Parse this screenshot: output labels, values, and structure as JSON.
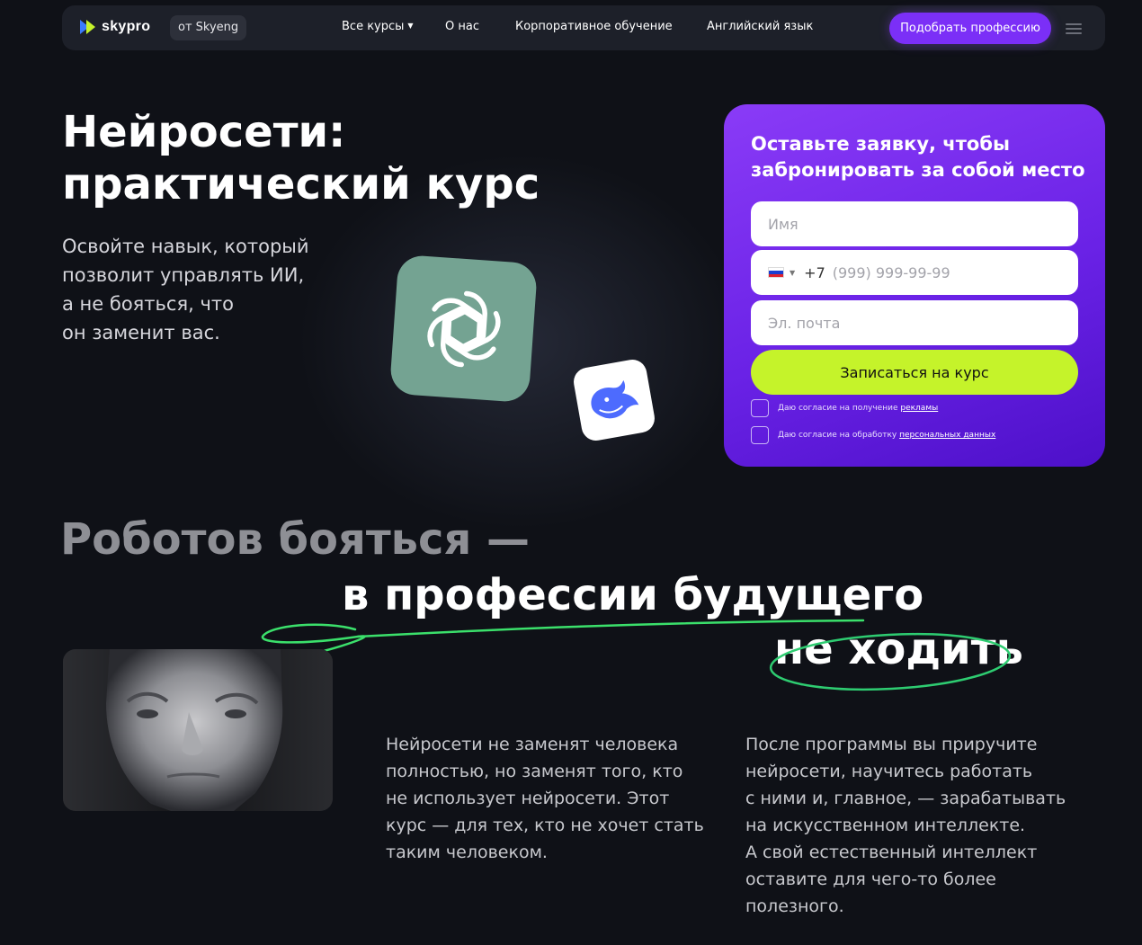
{
  "nav": {
    "logo_text": "skypro",
    "from_badge": "от Skyeng",
    "links": [
      "Все курсы",
      "О нас",
      "Корпоративное обучение",
      "Английский язык"
    ],
    "cta": "Подобрать профессию",
    "menu_icon": "burger-icon"
  },
  "hero": {
    "title_line1": "Нейросети:",
    "title_line2": "практический курс",
    "subtitle": [
      "Освойте навык, который",
      "позволит управлять ИИ,",
      "а не бояться, что",
      "он заменит вас."
    ],
    "icons": [
      "chatgpt-logo",
      "deepseek-logo"
    ]
  },
  "form": {
    "title": "Оставьте заявку, чтобы забронировать за собой место",
    "name_placeholder": "Имя",
    "phone_code": "+7",
    "phone_placeholder": "(999) 999-99-99",
    "email_placeholder": "Эл. почта",
    "submit": "Записаться на курс",
    "consent1_text": "Даю согласие на получение ",
    "consent1_link": "рекламы",
    "consent2_text": "Даю согласие на обработку ",
    "consent2_link": "персональных данных"
  },
  "section2": {
    "heading_grey": "Роботов бояться —",
    "heading_line2": "в профессии будущего",
    "heading_line3": "не ходить",
    "col1": [
      "Нейросети не заменят человека",
      "полностью, но заменят того, кто",
      "не использует нейросети. Этот",
      "курс — для тех, кто не хочет стать",
      "таким человеком."
    ],
    "col2": [
      "После программы вы приручите",
      "нейросети, научитесь работать",
      "с ними и, главное, — зарабатывать",
      "на искусственном интеллекте.",
      "А свой естественный интеллект",
      "оставите для чего-то более",
      "полезного."
    ]
  },
  "colors": {
    "background": "#0f1117",
    "accent_purple": "#7b2ff7",
    "accent_lime": "#c5f32a",
    "scribble_green": "#2ecc71"
  }
}
